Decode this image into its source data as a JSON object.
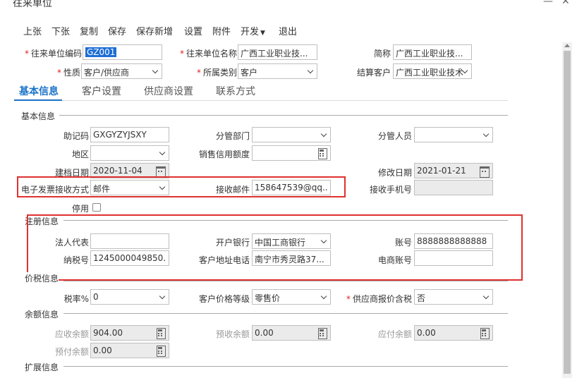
{
  "window": {
    "title": "往来单位",
    "close": "✕"
  },
  "toolbar": [
    {
      "label": "上张"
    },
    {
      "label": "下张"
    },
    {
      "label": "复制"
    },
    {
      "label": "保存"
    },
    {
      "label": "保存新增"
    },
    {
      "label": "设置"
    },
    {
      "label": "附件"
    },
    {
      "label": "开发"
    },
    {
      "label": "退出"
    }
  ],
  "header": {
    "code_label": "往来单位编码",
    "code_value": "GZ001",
    "name_label": "往来单位名称",
    "name_value": "广西工业职业技...",
    "short_label": "简称",
    "short_value": "广西工业职业技...",
    "nature_label": "性质",
    "nature_value": "客户/供应商",
    "category_label": "所属类别",
    "category_value": "客户",
    "settle_label": "结算客户",
    "settle_value": "广西工业职业技术"
  },
  "tabs": [
    {
      "label": "基本信息"
    },
    {
      "label": "客户设置"
    },
    {
      "label": "供应商设置"
    },
    {
      "label": "联系方式"
    }
  ],
  "basic": {
    "section": "基本信息",
    "mnemonic_label": "助记码",
    "mnemonic_value": "GXGYZYJSXY",
    "dept_label": "分管部门",
    "dept_value": "",
    "person_label": "分管人员",
    "person_value": "",
    "region_label": "地区",
    "region_value": "",
    "credit_label": "销售信用额度",
    "credit_value": "",
    "created_label": "建档日期",
    "created_value": "2020-11-04",
    "modified_label": "修改日期",
    "modified_value": "2021-01-21",
    "einvoice_label": "电子发票接收方式",
    "einvoice_value": "邮件",
    "email_label": "接收邮件",
    "email_value": "158647539@qq....",
    "phone_label": "接收手机号",
    "phone_value": "",
    "disabled_label": "停用"
  },
  "register": {
    "section": "注册信息",
    "legal_label": "法人代表",
    "legal_value": "",
    "bank_label": "开户银行",
    "bank_value": "中国工商银行",
    "account_label": "账号",
    "account_value": "8888888888888",
    "tax_label": "纳税号",
    "tax_value": "1245000049850...",
    "address_label": "客户地址电话",
    "address_value": "南宁市秀灵路37...",
    "ecom_label": "电商账号",
    "ecom_value": ""
  },
  "pricetax": {
    "section": "价税信息",
    "rate_label": "税率%",
    "rate_value": "0",
    "level_label": "客户价格等级",
    "level_value": "零售价",
    "supplier_label": "供应商报价含税",
    "supplier_value": "否"
  },
  "balance": {
    "section": "余额信息",
    "receivable_label": "应收余额",
    "receivable_value": "904.00",
    "prereceive_label": "预收余额",
    "prereceive_value": "0.00",
    "payable_label": "应付余额",
    "payable_value": "0.00",
    "prepay_label": "预付余额",
    "prepay_value": "0.00"
  },
  "extend": {
    "section": "扩展信息"
  },
  "colors": {
    "accent": "#1a73c8",
    "highlight_box": "#e03030",
    "required": "#e02020"
  }
}
